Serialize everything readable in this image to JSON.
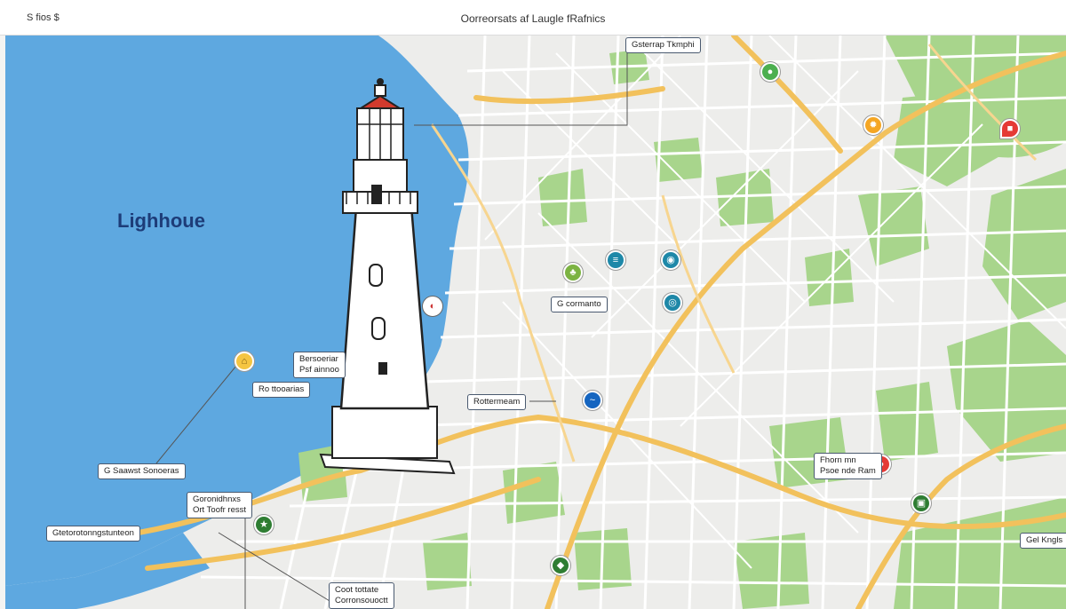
{
  "header": {
    "left_text": "S fios $",
    "title": "Oorreorsats af Laugle fRafnics"
  },
  "map": {
    "title_label": "Lighhoue",
    "callouts": [
      {
        "id": "c1",
        "text": "Gsterrap Tkmphi"
      },
      {
        "id": "c2",
        "text": "Bersoeriar\nPsf ainnoo"
      },
      {
        "id": "c3",
        "text": "Ro ttooarias"
      },
      {
        "id": "c4",
        "text": "G Saawst Sonoeras"
      },
      {
        "id": "c5",
        "text": "Goronidhnxs\nOrt Toofr resst"
      },
      {
        "id": "c6",
        "text": "Gtetorotonngstunteon"
      },
      {
        "id": "c7",
        "text": "G cormanto"
      },
      {
        "id": "c8",
        "text": "Rottermeam"
      },
      {
        "id": "c9",
        "text": "Fhorn mn\nPsoe nde Ram"
      },
      {
        "id": "c10",
        "text": "Gel Kngls"
      },
      {
        "id": "c11",
        "text": "Coot tottate\nCorronsouoctt"
      }
    ],
    "pin_icons": [
      "food-icon",
      "sun-icon",
      "info-icon",
      "ship-icon",
      "pin-icon",
      "compass-icon",
      "tree-icon",
      "camera-icon",
      "bank-icon",
      "star-icon",
      "water-icon",
      "road-icon",
      "building-icon",
      "leaf-icon"
    ],
    "colors": {
      "water": "#5ea8e0",
      "land": "#ededeb",
      "park": "#a8d58c",
      "major_road": "#f2c15c",
      "minor_road": "#ffffff"
    }
  }
}
